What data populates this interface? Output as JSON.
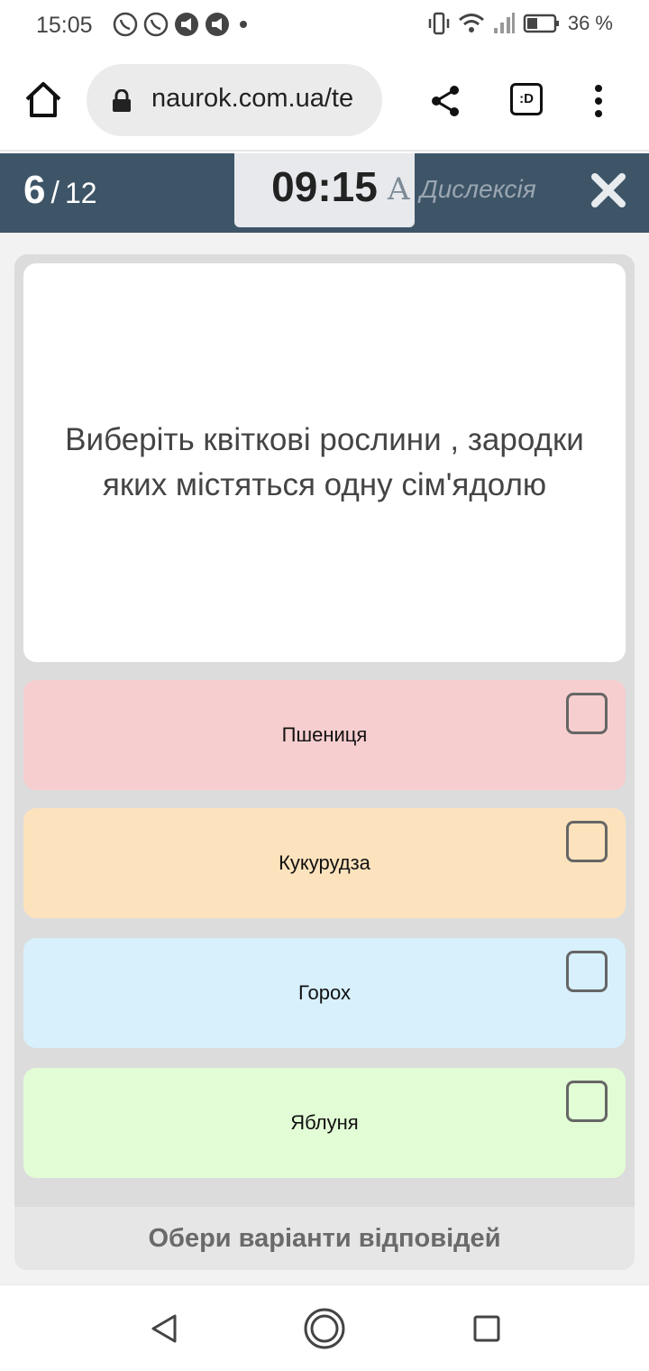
{
  "status_bar": {
    "time": "15:05",
    "left_icons": [
      "viber-icon",
      "viber-icon",
      "notification-icon",
      "notification-icon",
      "dot-icon"
    ],
    "battery_percent": "36 %"
  },
  "browser": {
    "url": "naurok.com.ua/te",
    "tab_button_label": ":D"
  },
  "quiz": {
    "current": "6",
    "separator": "/",
    "total": "12",
    "timer": "09:15",
    "dyslexia_icon": "A",
    "dyslexia_label": "Дислексія",
    "question": "Виберіть квіткові рослини , зародки яких містяться одну сім'ядолю",
    "answers": [
      {
        "label": "Пшениця",
        "color": "#f7cecf"
      },
      {
        "label": "Кукурудза",
        "color": "#fce3bd"
      },
      {
        "label": "Горох",
        "color": "#d7f0fb"
      },
      {
        "label": "Яблуня",
        "color": "#e2fdd5"
      }
    ],
    "footer": "Обери варіанти відповідей"
  },
  "colors": {
    "header_bg": "#3e5568",
    "panel_bg": "#dcdcdc"
  }
}
